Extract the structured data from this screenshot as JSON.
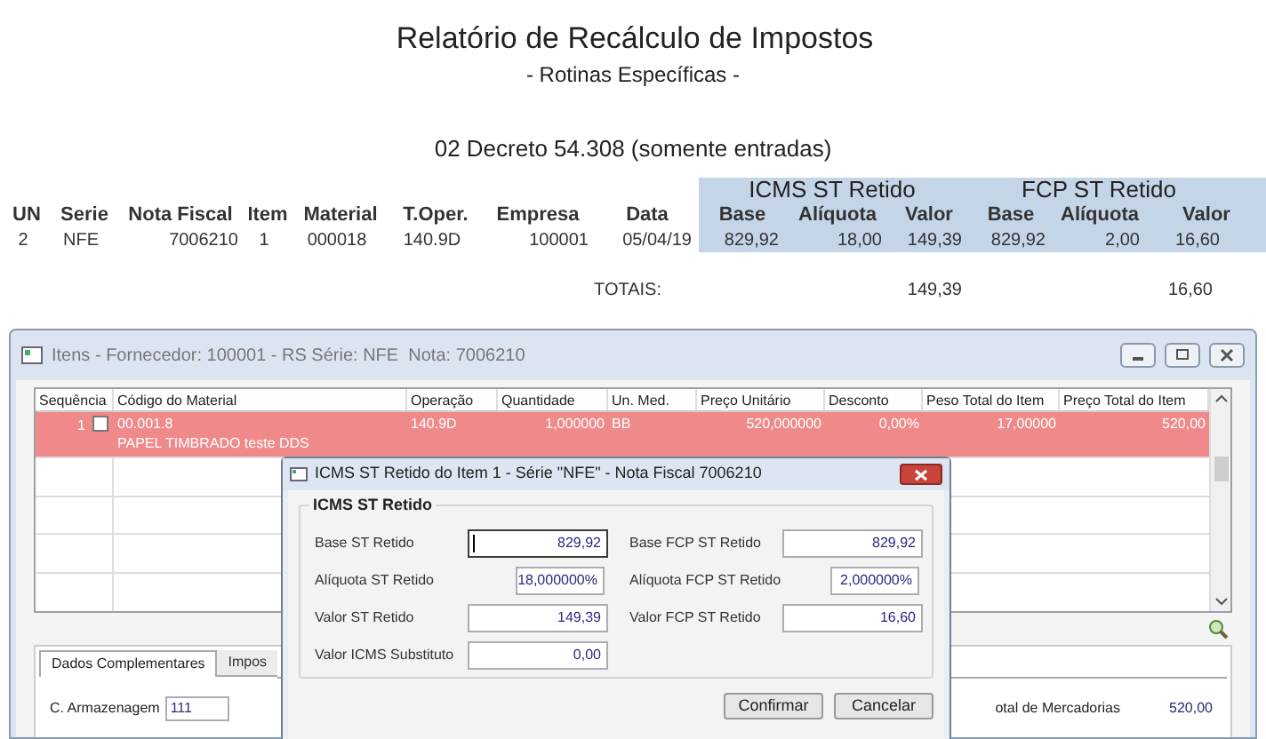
{
  "report": {
    "title": "Relatório de Recálculo de Impostos",
    "subtitle": "- Rotinas Específicas -",
    "section": "02 Decreto 54.308 (somente entradas)",
    "group_headers": [
      "ICMS ST Retido",
      "FCP ST Retido"
    ],
    "columns": [
      "UN",
      "Serie",
      "Nota Fiscal",
      "Item",
      "Material",
      "T.Oper.",
      "Empresa",
      "Data",
      "Base",
      "Alíquota",
      "Valor",
      "Base",
      "Alíquota",
      "Valor"
    ],
    "rows": [
      [
        "2",
        "NFE",
        "7006210",
        "1",
        "000018",
        "140.9D",
        "100001",
        "05/04/19",
        "829,92",
        "18,00",
        "149,39",
        "829,92",
        "2,00",
        "16,60"
      ]
    ],
    "totals_label": "TOTAIS:",
    "totals": [
      "149,39",
      "16,60"
    ]
  },
  "window": {
    "title": "Itens - Fornecedor: 100001 - RS Série: NFE  Nota: 7006210",
    "grid": {
      "columns": [
        "Sequência",
        "Código do Material",
        "Operação",
        "Quantidade",
        "Un. Med.",
        "Preço Unitário",
        "Desconto",
        "Peso Total do Item",
        "Preço Total do Item"
      ],
      "rows": [
        {
          "selected": true,
          "checked": false,
          "sequence": "1",
          "code": "00.001.8",
          "description": "PAPEL TIMBRADO teste DDS",
          "operation": "140.9D",
          "quantity": "1,000000",
          "unit": "BB",
          "unit_price": "520,000000",
          "discount": "0,00%",
          "weight": "17,00000",
          "total": "520,00"
        }
      ]
    },
    "tabs": [
      {
        "label": "Dados Complementares",
        "selected": true
      },
      {
        "label": "Impos",
        "selected": false
      }
    ],
    "storage": {
      "label": "C. Armazenagem",
      "value": "111"
    },
    "goods_total": {
      "label": "otal de Mercadorias",
      "value": "520,00"
    }
  },
  "dialog": {
    "title": "ICMS ST Retido do Item 1 - Série \"NFE\" - Nota Fiscal 7006210",
    "group": "ICMS ST Retido",
    "left_fields": [
      {
        "label": "Base ST Retido",
        "value": "829,92",
        "kind": "wide",
        "focused": true
      },
      {
        "label": "Alíquota ST Retido",
        "value": "18,000000%",
        "kind": "narrow",
        "focused": false
      },
      {
        "label": "Valor ST Retido",
        "value": "149,39",
        "kind": "wide",
        "focused": false
      },
      {
        "label": "Valor ICMS Substituto",
        "value": "0,00",
        "kind": "wide",
        "focused": false
      }
    ],
    "right_fields": [
      {
        "label": "Base FCP ST Retido",
        "value": "829,92",
        "kind": "wide",
        "focused": false
      },
      {
        "label": "Alíquota FCP ST Retido",
        "value": "2,000000%",
        "kind": "narrow",
        "focused": false
      },
      {
        "label": "Valor FCP ST Retido",
        "value": "16,60",
        "kind": "wide",
        "focused": false
      }
    ],
    "buttons": [
      "Confirmar",
      "Cancelar"
    ]
  }
}
